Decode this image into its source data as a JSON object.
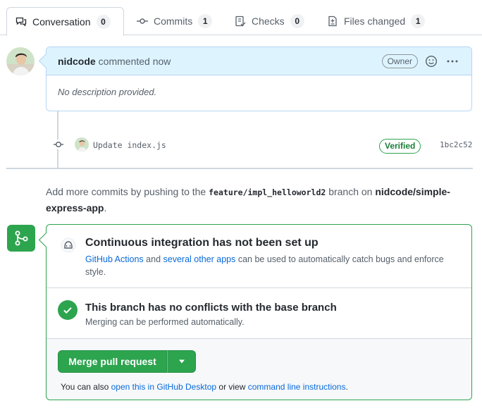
{
  "tabs": [
    {
      "label": "Conversation",
      "count": "0",
      "icon": "comment-discussion-icon"
    },
    {
      "label": "Commits",
      "count": "1",
      "icon": "git-commit-icon"
    },
    {
      "label": "Checks",
      "count": "0",
      "icon": "checklist-icon"
    },
    {
      "label": "Files changed",
      "count": "1",
      "icon": "file-diff-icon"
    }
  ],
  "comment": {
    "author": "nidcode",
    "action": "commented now",
    "badge": "Owner",
    "body": "No description provided."
  },
  "commit": {
    "message": "Update index.js",
    "verified": "Verified",
    "sha": "1bc2c52"
  },
  "push_info": {
    "prefix": "Add more commits by pushing to the",
    "branch": "feature/impl_helloworld2",
    "middle": "branch on",
    "repo": "nidcode/simple-express-app",
    "suffix": "."
  },
  "ci": {
    "title": "Continuous integration has not been set up",
    "link1": "GitHub Actions",
    "and": "and",
    "link2": "several other apps",
    "rest": "can be used to automatically catch bugs and enforce style."
  },
  "conflicts": {
    "title": "This branch has no conflicts with the base branch",
    "desc": "Merging can be performed automatically."
  },
  "merge": {
    "button": "Merge pull request",
    "also_prefix": "You can also",
    "desktop_link": "open this in GitHub Desktop",
    "or_view": "or view",
    "cli_link": "command line instructions",
    "suffix": "."
  },
  "colors": {
    "green": "#2da44e",
    "blue": "#0969da",
    "header_blue": "#ddf4ff"
  }
}
